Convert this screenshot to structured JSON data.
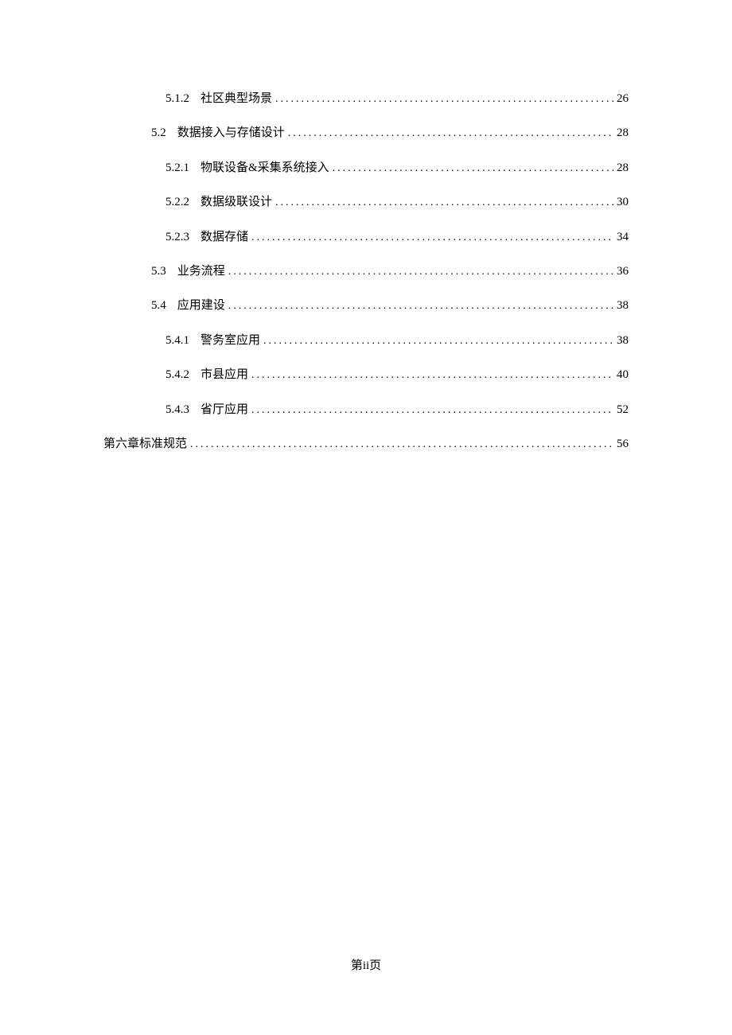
{
  "toc": [
    {
      "level": 3,
      "num": "5.1.2",
      "title": "社区典型场景",
      "page": "26"
    },
    {
      "level": 2,
      "num": "5.2",
      "title": "数据接入与存储设计",
      "page": "28"
    },
    {
      "level": 3,
      "num": "5.2.1",
      "title": "物联设备&采集系统接入",
      "page": "28"
    },
    {
      "level": 3,
      "num": "5.2.2",
      "title": "数据级联设计",
      "page": "30"
    },
    {
      "level": 3,
      "num": "5.2.3",
      "title": "数据存储",
      "page": "34"
    },
    {
      "level": 2,
      "num": "5.3",
      "title": "业务流程",
      "page": "36"
    },
    {
      "level": 2,
      "num": "5.4",
      "title": "应用建设",
      "page": "38"
    },
    {
      "level": 3,
      "num": "5.4.1",
      "title": "警务室应用",
      "page": "38"
    },
    {
      "level": 3,
      "num": "5.4.2",
      "title": "市县应用",
      "page": "40"
    },
    {
      "level": 3,
      "num": "5.4.3",
      "title": "省厅应用",
      "page": "52"
    },
    {
      "level": 1,
      "num": "",
      "title": "第六章标准规范",
      "page": "56"
    }
  ],
  "footer": "第ii页"
}
